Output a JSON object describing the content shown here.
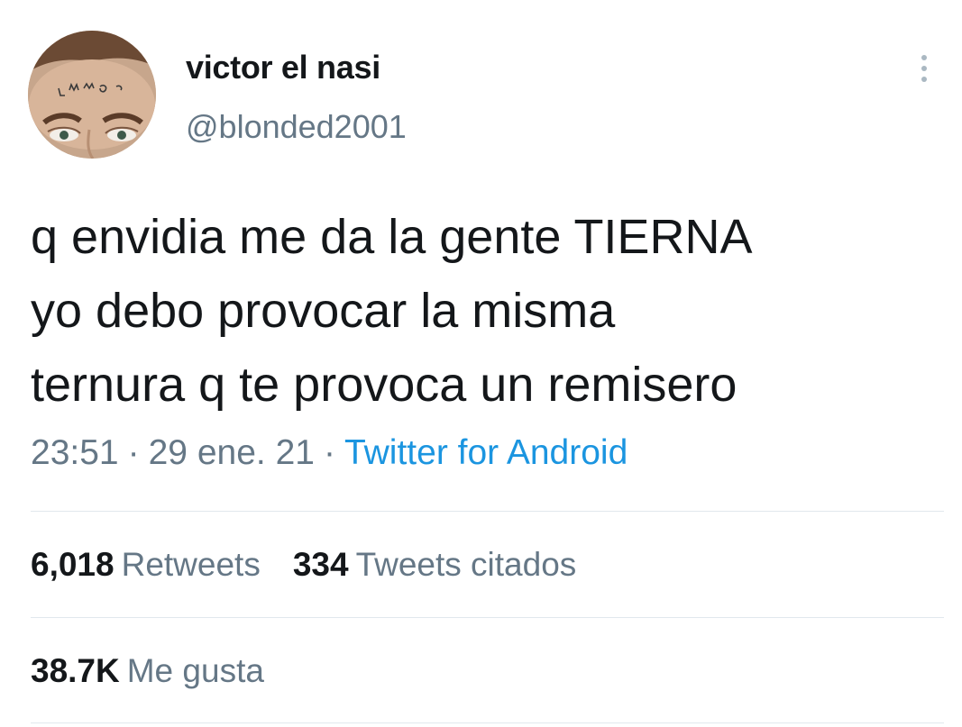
{
  "user": {
    "display_name": "victor el nasi",
    "handle": "@blonded2001"
  },
  "tweet": {
    "lines": [
      "q envidia me da la gente TIERNA",
      "yo debo provocar la misma",
      "ternura q te provoca un remisero"
    ],
    "time": "23:51",
    "date": "29 ene. 21",
    "separator": "·",
    "source": "Twitter for Android"
  },
  "stats": {
    "retweets_count": "6,018",
    "retweets_label": "Retweets",
    "quotes_count": "334",
    "quotes_label": "Tweets citados",
    "likes_count": "38.7K",
    "likes_label": "Me gusta"
  },
  "icons": {
    "more": "more-vertical-icon"
  },
  "colors": {
    "text_primary": "#14171a",
    "text_secondary": "#657786",
    "link": "#1b95e0",
    "divider": "#e1e8ed"
  }
}
